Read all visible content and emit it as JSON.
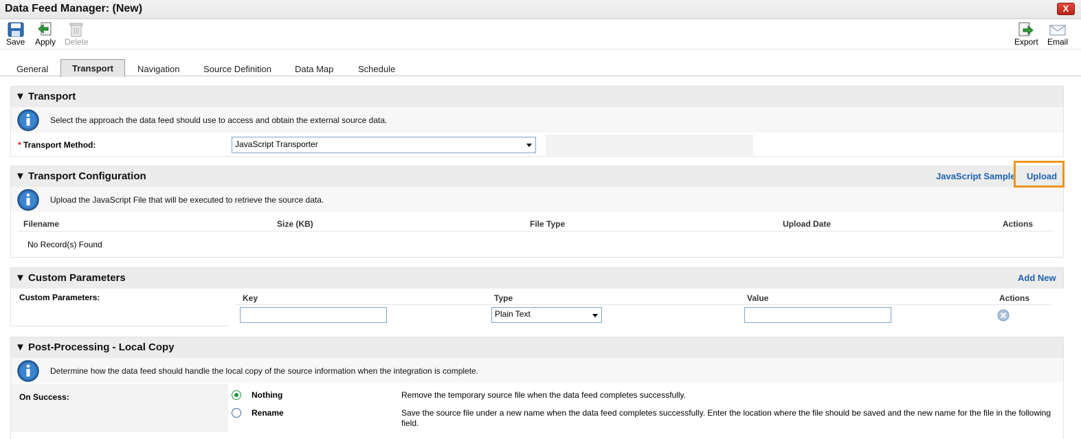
{
  "window": {
    "title": "Data Feed Manager: (New)",
    "close_label": "X"
  },
  "toolbar": {
    "save": "Save",
    "apply": "Apply",
    "delete": "Delete",
    "export": "Export",
    "email": "Email"
  },
  "tabs": [
    "General",
    "Transport",
    "Navigation",
    "Source Definition",
    "Data Map",
    "Schedule"
  ],
  "active_tab": "Transport",
  "transport": {
    "title": "Transport",
    "info": "Select the approach the data feed should use to access and obtain the external source data.",
    "required_mark": "*",
    "method_label": "Transport Method:",
    "method_value": "JavaScript Transporter"
  },
  "config": {
    "title": "Transport Configuration",
    "sample_link": "JavaScript Sample",
    "upload_link": "Upload",
    "info": "Upload the JavaScript File that will be executed to retrieve the source data.",
    "columns": [
      "Filename",
      "Size (KB)",
      "File Type",
      "Upload Date",
      "Actions"
    ],
    "empty": "No Record(s) Found"
  },
  "params": {
    "title": "Custom Parameters",
    "add_new": "Add New",
    "label": "Custom Parameters:",
    "columns": [
      "Key",
      "Type",
      "Value",
      "Actions"
    ],
    "type_value": "Plain Text",
    "key_value": "",
    "value_value": ""
  },
  "post": {
    "title": "Post-Processing - Local Copy",
    "info": "Determine how the data feed should handle the local copy of the source information when the integration is complete.",
    "on_success_label": "On Success:",
    "options": [
      {
        "label": "Nothing",
        "desc": "Remove the temporary source file when the data feed completes successfully.",
        "selected": true
      },
      {
        "label": "Rename",
        "desc": "Save the source file under a new name when the data feed completes successfully.  Enter the location where the file should be saved and the new name for the file in the following field.",
        "selected": false
      }
    ]
  },
  "colors": {
    "link": "#1f62ad",
    "highlight": "#e8961e",
    "section_header": "#ececec"
  }
}
